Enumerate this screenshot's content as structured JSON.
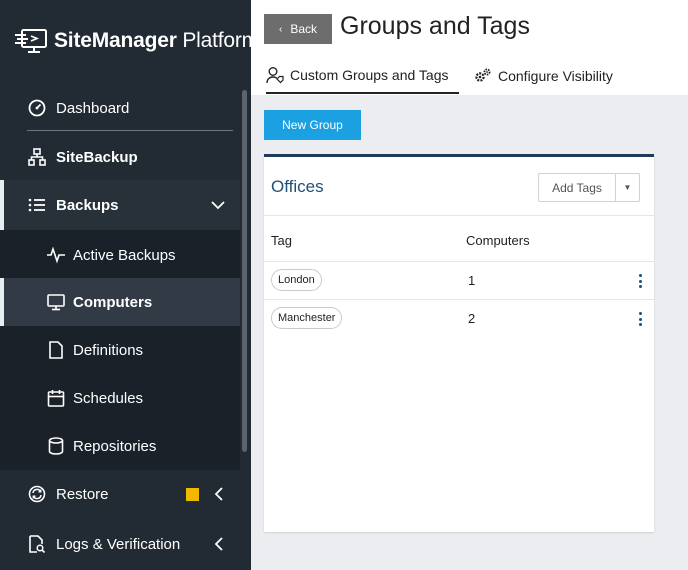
{
  "app": {
    "logo_bold": "SiteManager",
    "logo_light": " Platform"
  },
  "sidebar": {
    "items": [
      {
        "label": "Dashboard",
        "icon": "gauge-icon"
      },
      {
        "label": "SiteBackup",
        "icon": "sitemap-icon"
      },
      {
        "label": "Backups",
        "icon": "list-icon"
      },
      {
        "label": "Active Backups",
        "icon": "activity-icon"
      },
      {
        "label": "Computers",
        "icon": "monitor-icon"
      },
      {
        "label": "Definitions",
        "icon": "file-icon"
      },
      {
        "label": "Schedules",
        "icon": "calendar-icon"
      },
      {
        "label": "Repositories",
        "icon": "database-icon"
      },
      {
        "label": "Restore",
        "icon": "restore-icon"
      },
      {
        "label": "Logs & Verification",
        "icon": "file-search-icon"
      }
    ],
    "badge_color": "#f0b800"
  },
  "header": {
    "back_label": "Back",
    "title": "Groups and Tags",
    "tabs": [
      {
        "label": "Custom Groups and Tags",
        "icon": "user-tag-icon",
        "active": true
      },
      {
        "label": "Configure Visibility",
        "icon": "gears-icon",
        "active": false
      }
    ]
  },
  "toolbar": {
    "new_group_label": "New Group"
  },
  "group": {
    "title": "Offices",
    "add_tags_label": "Add Tags",
    "columns": [
      "Tag",
      "Computers"
    ],
    "rows": [
      {
        "tag": "London",
        "computers": "1"
      },
      {
        "tag": "Manchester",
        "computers": "2"
      }
    ]
  },
  "colors": {
    "sidebar_bg": "#222a33",
    "accent_blue": "#1ba1e2",
    "panel_title": "#1f4f7a"
  }
}
